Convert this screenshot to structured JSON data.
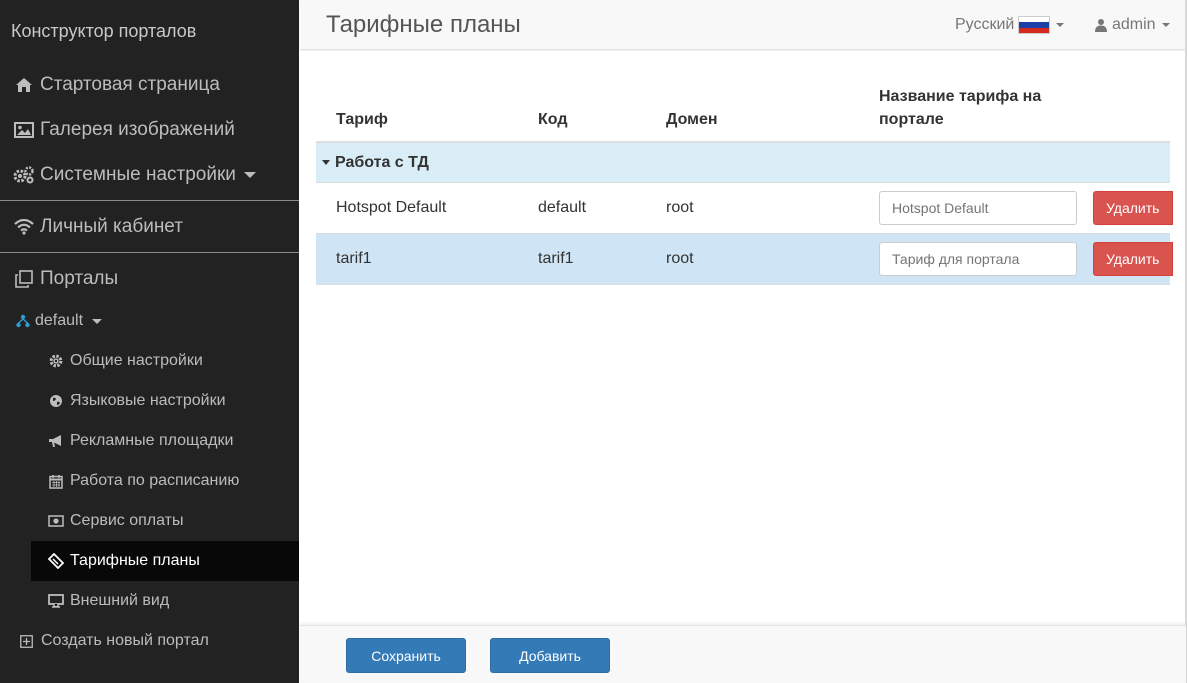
{
  "sidebar": {
    "brand": "Конструктор порталов",
    "items": [
      {
        "label": "Стартовая страница",
        "icon": "home-icon"
      },
      {
        "label": "Галерея изображений",
        "icon": "image-icon"
      },
      {
        "label": "Системные настройки",
        "icon": "cogs-icon"
      },
      {
        "label": "Личный кабинет",
        "icon": "wifi-icon"
      },
      {
        "label": "Порталы",
        "icon": "clone-icon"
      }
    ],
    "portal": {
      "label": "default",
      "icon": "sitemap-icon"
    },
    "sub_items": [
      {
        "label": "Общие настройки",
        "icon": "gear-icon"
      },
      {
        "label": "Языковые настройки",
        "icon": "globe-icon"
      },
      {
        "label": "Рекламные площадки",
        "icon": "bullhorn-icon"
      },
      {
        "label": "Работа по расписанию",
        "icon": "calendar-icon"
      },
      {
        "label": "Сервис оплаты",
        "icon": "money-icon"
      },
      {
        "label": "Тарифные планы",
        "icon": "ticket-icon"
      },
      {
        "label": "Внешний вид",
        "icon": "desktop-icon"
      }
    ],
    "create_portal": "Создать новый портал"
  },
  "header": {
    "title": "Тарифные планы",
    "language": "Русский",
    "user": "admin"
  },
  "table": {
    "columns": [
      "Тариф",
      "Код",
      "Домен",
      "Название тарифа на портале"
    ],
    "group": "Работа с ТД",
    "rows": [
      {
        "tariff": "Hotspot Default",
        "code": "default",
        "domain": "root",
        "portal_name_placeholder": "Hotspot Default",
        "delete_label": "Удалить"
      },
      {
        "tariff": "tarif1",
        "code": "tarif1",
        "domain": "root",
        "portal_name_placeholder": "Тариф для портала",
        "delete_label": "Удалить"
      }
    ]
  },
  "footer": {
    "save_label": "Сохранить",
    "add_label": "Добавить"
  },
  "colors": {
    "sidebar_bg": "#222222",
    "primary": "#337ab7",
    "danger": "#d9534f",
    "group_bg": "#d9edf7",
    "highlight_row": "#cfe5f5"
  }
}
